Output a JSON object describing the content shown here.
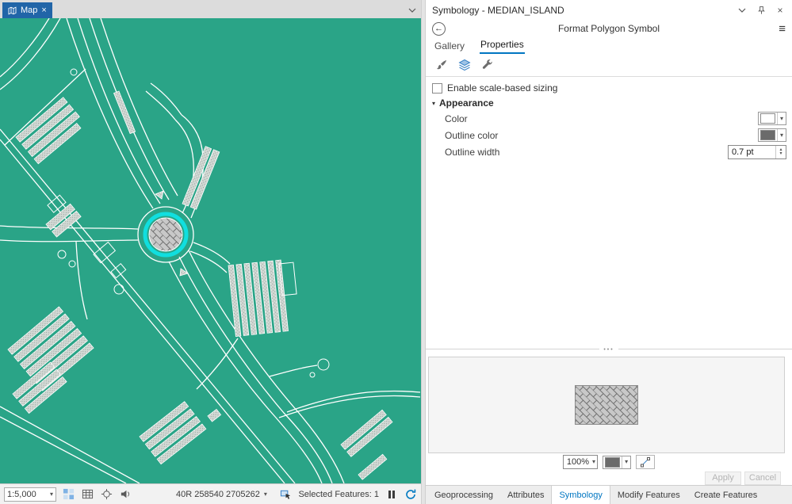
{
  "colors": {
    "accent": "#0076c2",
    "map_background": "#2aa487",
    "selection_cyan": "#10dfdf",
    "map_tab_blue": "#2165a8",
    "fill_swatch": "#ffffff",
    "outline_swatch": "#6b6b6b"
  },
  "glyphs": {
    "close": "×",
    "dropdown": "▾",
    "up": "▴",
    "menu": "≡",
    "back": "←",
    "dots": "•••"
  },
  "map": {
    "tab_label": "Map",
    "status": {
      "scale": "1:5,000",
      "coordinates": "40R 258540 2705262",
      "selected_features_label": "Selected Features:",
      "selected_features_count": "1"
    }
  },
  "pane": {
    "title": "Symbology - MEDIAN_ISLAND",
    "subtitle": "Format Polygon Symbol",
    "tabs": [
      {
        "label": "Gallery"
      },
      {
        "label": "Properties"
      }
    ],
    "checkbox_label": "Enable scale-based sizing",
    "section_label": "Appearance",
    "properties": {
      "color_label": "Color",
      "outline_color_label": "Outline color",
      "outline_width_label": "Outline width",
      "outline_width_value": "0.7 pt"
    },
    "preview": {
      "zoom_value": "100%"
    },
    "apply_label": "Apply",
    "cancel_label": "Cancel"
  },
  "bottom_tabs": {
    "active": "Symbology",
    "items": [
      {
        "label": "Geoprocessing"
      },
      {
        "label": "Attributes"
      },
      {
        "label": "Symbology"
      },
      {
        "label": "Modify Features"
      },
      {
        "label": "Create Features"
      }
    ]
  }
}
